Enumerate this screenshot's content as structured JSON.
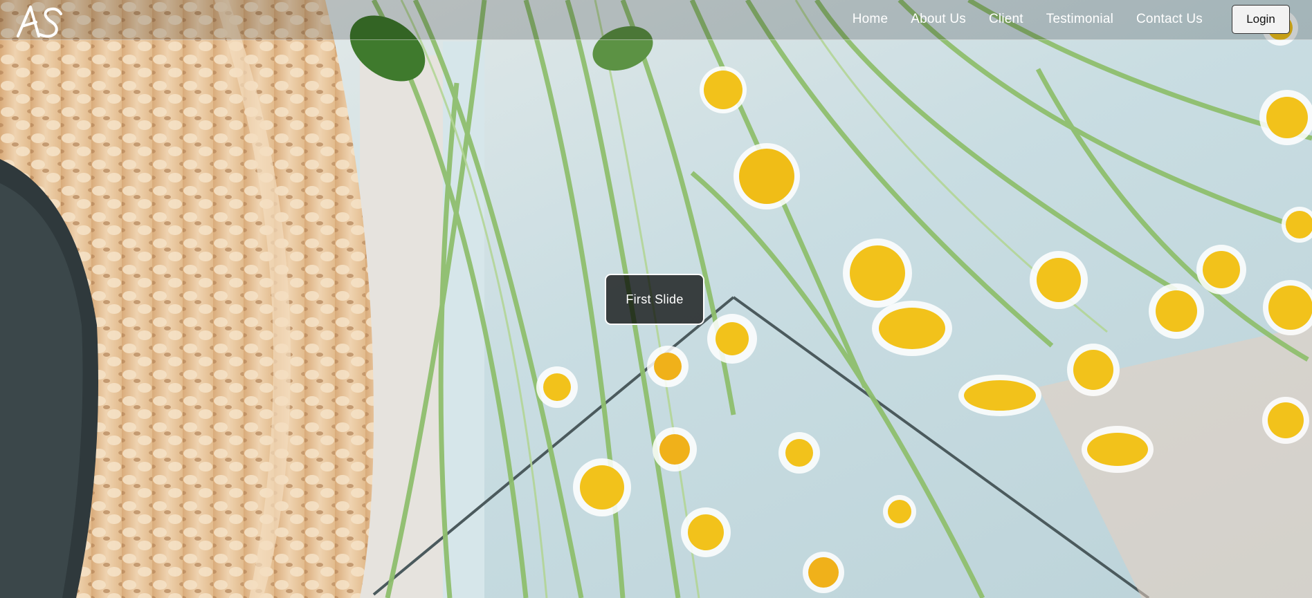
{
  "brand": {
    "logo_text": "AS"
  },
  "nav": {
    "items": [
      {
        "label": "Home"
      },
      {
        "label": "About Us"
      },
      {
        "label": "Client"
      },
      {
        "label": "Testimonial"
      },
      {
        "label": "Contact Us"
      }
    ],
    "login_label": "Login"
  },
  "carousel": {
    "caption": "First Slide"
  },
  "colors": {
    "navbar_overlay": "#000000",
    "caption_bg": "#000000",
    "flower_center": "#f2c21b",
    "basket": "#e6c39a"
  }
}
